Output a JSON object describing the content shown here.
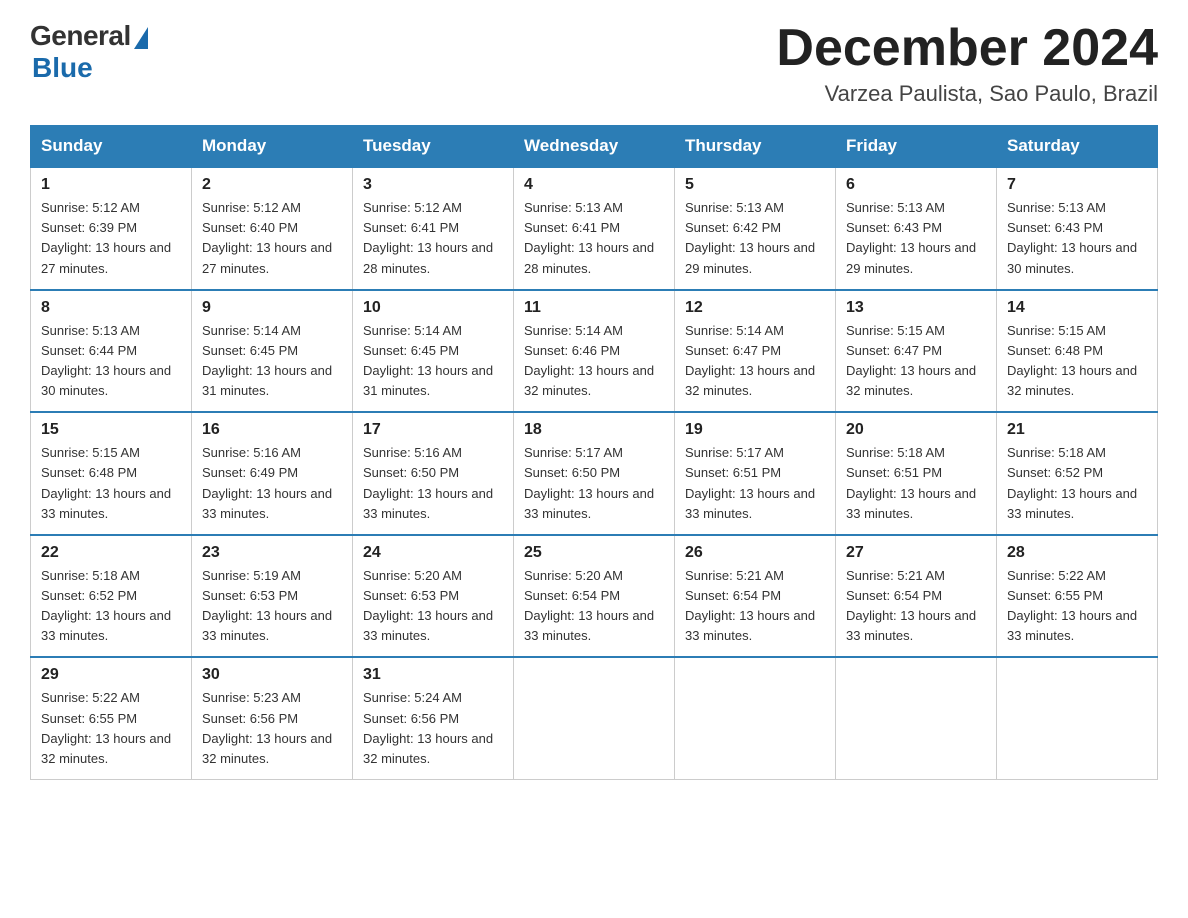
{
  "header": {
    "logo_general": "General",
    "logo_blue": "Blue",
    "title": "December 2024",
    "location": "Varzea Paulista, Sao Paulo, Brazil"
  },
  "days_of_week": [
    "Sunday",
    "Monday",
    "Tuesday",
    "Wednesday",
    "Thursday",
    "Friday",
    "Saturday"
  ],
  "weeks": [
    [
      {
        "num": "1",
        "sunrise": "5:12 AM",
        "sunset": "6:39 PM",
        "daylight": "13 hours and 27 minutes."
      },
      {
        "num": "2",
        "sunrise": "5:12 AM",
        "sunset": "6:40 PM",
        "daylight": "13 hours and 27 minutes."
      },
      {
        "num": "3",
        "sunrise": "5:12 AM",
        "sunset": "6:41 PM",
        "daylight": "13 hours and 28 minutes."
      },
      {
        "num": "4",
        "sunrise": "5:13 AM",
        "sunset": "6:41 PM",
        "daylight": "13 hours and 28 minutes."
      },
      {
        "num": "5",
        "sunrise": "5:13 AM",
        "sunset": "6:42 PM",
        "daylight": "13 hours and 29 minutes."
      },
      {
        "num": "6",
        "sunrise": "5:13 AM",
        "sunset": "6:43 PM",
        "daylight": "13 hours and 29 minutes."
      },
      {
        "num": "7",
        "sunrise": "5:13 AM",
        "sunset": "6:43 PM",
        "daylight": "13 hours and 30 minutes."
      }
    ],
    [
      {
        "num": "8",
        "sunrise": "5:13 AM",
        "sunset": "6:44 PM",
        "daylight": "13 hours and 30 minutes."
      },
      {
        "num": "9",
        "sunrise": "5:14 AM",
        "sunset": "6:45 PM",
        "daylight": "13 hours and 31 minutes."
      },
      {
        "num": "10",
        "sunrise": "5:14 AM",
        "sunset": "6:45 PM",
        "daylight": "13 hours and 31 minutes."
      },
      {
        "num": "11",
        "sunrise": "5:14 AM",
        "sunset": "6:46 PM",
        "daylight": "13 hours and 32 minutes."
      },
      {
        "num": "12",
        "sunrise": "5:14 AM",
        "sunset": "6:47 PM",
        "daylight": "13 hours and 32 minutes."
      },
      {
        "num": "13",
        "sunrise": "5:15 AM",
        "sunset": "6:47 PM",
        "daylight": "13 hours and 32 minutes."
      },
      {
        "num": "14",
        "sunrise": "5:15 AM",
        "sunset": "6:48 PM",
        "daylight": "13 hours and 32 minutes."
      }
    ],
    [
      {
        "num": "15",
        "sunrise": "5:15 AM",
        "sunset": "6:48 PM",
        "daylight": "13 hours and 33 minutes."
      },
      {
        "num": "16",
        "sunrise": "5:16 AM",
        "sunset": "6:49 PM",
        "daylight": "13 hours and 33 minutes."
      },
      {
        "num": "17",
        "sunrise": "5:16 AM",
        "sunset": "6:50 PM",
        "daylight": "13 hours and 33 minutes."
      },
      {
        "num": "18",
        "sunrise": "5:17 AM",
        "sunset": "6:50 PM",
        "daylight": "13 hours and 33 minutes."
      },
      {
        "num": "19",
        "sunrise": "5:17 AM",
        "sunset": "6:51 PM",
        "daylight": "13 hours and 33 minutes."
      },
      {
        "num": "20",
        "sunrise": "5:18 AM",
        "sunset": "6:51 PM",
        "daylight": "13 hours and 33 minutes."
      },
      {
        "num": "21",
        "sunrise": "5:18 AM",
        "sunset": "6:52 PM",
        "daylight": "13 hours and 33 minutes."
      }
    ],
    [
      {
        "num": "22",
        "sunrise": "5:18 AM",
        "sunset": "6:52 PM",
        "daylight": "13 hours and 33 minutes."
      },
      {
        "num": "23",
        "sunrise": "5:19 AM",
        "sunset": "6:53 PM",
        "daylight": "13 hours and 33 minutes."
      },
      {
        "num": "24",
        "sunrise": "5:20 AM",
        "sunset": "6:53 PM",
        "daylight": "13 hours and 33 minutes."
      },
      {
        "num": "25",
        "sunrise": "5:20 AM",
        "sunset": "6:54 PM",
        "daylight": "13 hours and 33 minutes."
      },
      {
        "num": "26",
        "sunrise": "5:21 AM",
        "sunset": "6:54 PM",
        "daylight": "13 hours and 33 minutes."
      },
      {
        "num": "27",
        "sunrise": "5:21 AM",
        "sunset": "6:54 PM",
        "daylight": "13 hours and 33 minutes."
      },
      {
        "num": "28",
        "sunrise": "5:22 AM",
        "sunset": "6:55 PM",
        "daylight": "13 hours and 33 minutes."
      }
    ],
    [
      {
        "num": "29",
        "sunrise": "5:22 AM",
        "sunset": "6:55 PM",
        "daylight": "13 hours and 32 minutes."
      },
      {
        "num": "30",
        "sunrise": "5:23 AM",
        "sunset": "6:56 PM",
        "daylight": "13 hours and 32 minutes."
      },
      {
        "num": "31",
        "sunrise": "5:24 AM",
        "sunset": "6:56 PM",
        "daylight": "13 hours and 32 minutes."
      },
      null,
      null,
      null,
      null
    ]
  ]
}
